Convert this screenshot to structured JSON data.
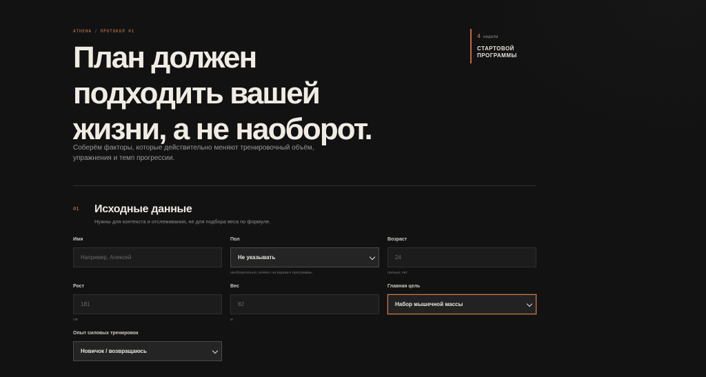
{
  "header": {
    "brand": "ATHENA",
    "separator": "/",
    "protocol_label": "ПРОТОКОЛ",
    "protocol_num": "01"
  },
  "hero": {
    "title_lines": [
      "План должен",
      "подходить вашей",
      "жизни, а не наоборот."
    ],
    "lead": "Соберём факторы, которые действительно меняют тренировочный объём, упражнения и темп прогрессии."
  },
  "aside": {
    "count": "4",
    "count_unit": "недели",
    "label": "СТАРТОВОЙ ПРОГРАММЫ"
  },
  "section": {
    "number": "01",
    "title": "Исходные данные",
    "subtitle": "Нужны для контекста и отслеживания, не для подбора веса по формуле."
  },
  "form": {
    "name": {
      "label": "Имя",
      "placeholder": "Например, Алексей"
    },
    "sex": {
      "label": "Пол",
      "value": "Не указывать",
      "hint": "необязательно; влияет на вариант программы"
    },
    "age": {
      "label": "Возраст",
      "placeholder": "24",
      "hint": "полных лет"
    },
    "height": {
      "label": "Рост",
      "placeholder": "181",
      "hint": "см"
    },
    "weight": {
      "label": "Вес",
      "placeholder": "82",
      "hint": "кг"
    },
    "goal": {
      "label": "Главная цель",
      "value": "Набор мышечной массы"
    },
    "experience": {
      "label": "Опыт силовых тренировок",
      "value": "Новичок / возвращаюсь"
    }
  },
  "colors": {
    "accent": "#c9835a",
    "focus_border": "#d27a44",
    "background": "#121212"
  }
}
